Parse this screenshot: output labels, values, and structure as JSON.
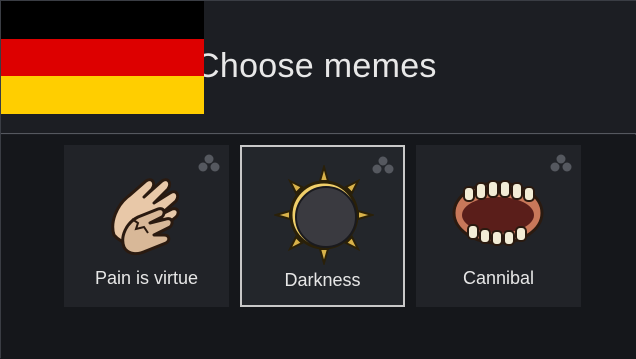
{
  "window": {
    "title": "Choose memes"
  },
  "flag": {
    "colors": [
      "#000000",
      "#dd0000",
      "#ffce00"
    ]
  },
  "memes": [
    {
      "label": "Pain is virtue",
      "icon": "clapping-hands-icon",
      "selected": false
    },
    {
      "label": "Darkness",
      "icon": "eclipse-icon",
      "selected": true
    },
    {
      "label": "Cannibal",
      "icon": "open-mouth-teeth-icon",
      "selected": false
    }
  ]
}
